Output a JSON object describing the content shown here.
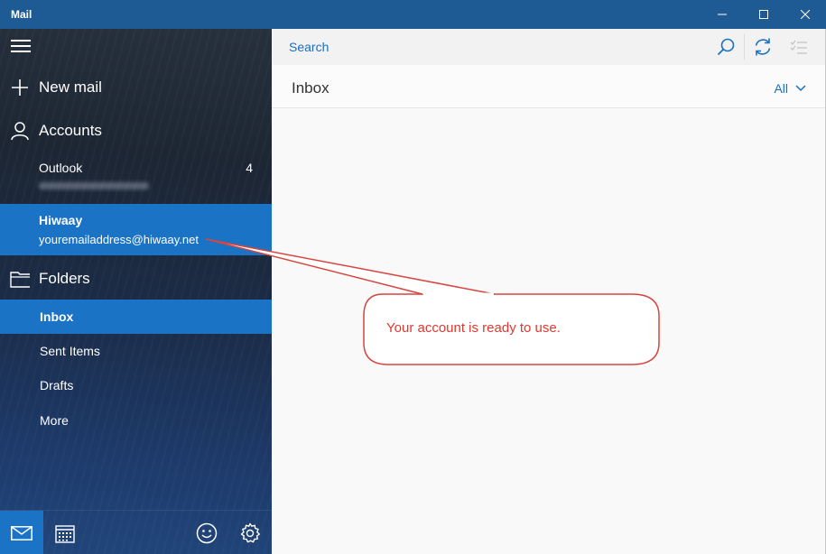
{
  "window": {
    "title": "Mail"
  },
  "sidebar": {
    "new_mail": "New mail",
    "accounts_label": "Accounts",
    "accounts": [
      {
        "name": "Outlook",
        "count": "4"
      },
      {
        "name": "Hiwaay",
        "email": "youremailaddress@hiwaay.net"
      }
    ],
    "folders_label": "Folders",
    "folders": [
      "Inbox",
      "Sent Items",
      "Drafts",
      "More"
    ]
  },
  "search": {
    "placeholder": "Search"
  },
  "inbox": {
    "title": "Inbox",
    "filter": "All"
  },
  "callout": {
    "text": "Your account is ready to use."
  },
  "colors": {
    "titlebar": "#1e5a93",
    "accent": "#1b73c6",
    "link": "#1a6fc0",
    "callout_red": "#e0392f"
  },
  "icons": {
    "minimize": "minimize-icon",
    "maximize": "maximize-icon",
    "close": "close-icon",
    "menu": "hamburger-icon",
    "new_mail": "plus-icon",
    "accounts": "person-icon",
    "folders": "folder-icon",
    "search": "search-icon",
    "sync": "sync-icon",
    "select": "select-mode-icon",
    "mail": "mail-icon",
    "calendar": "calendar-icon",
    "feedback": "smiley-icon",
    "settings": "gear-icon"
  }
}
